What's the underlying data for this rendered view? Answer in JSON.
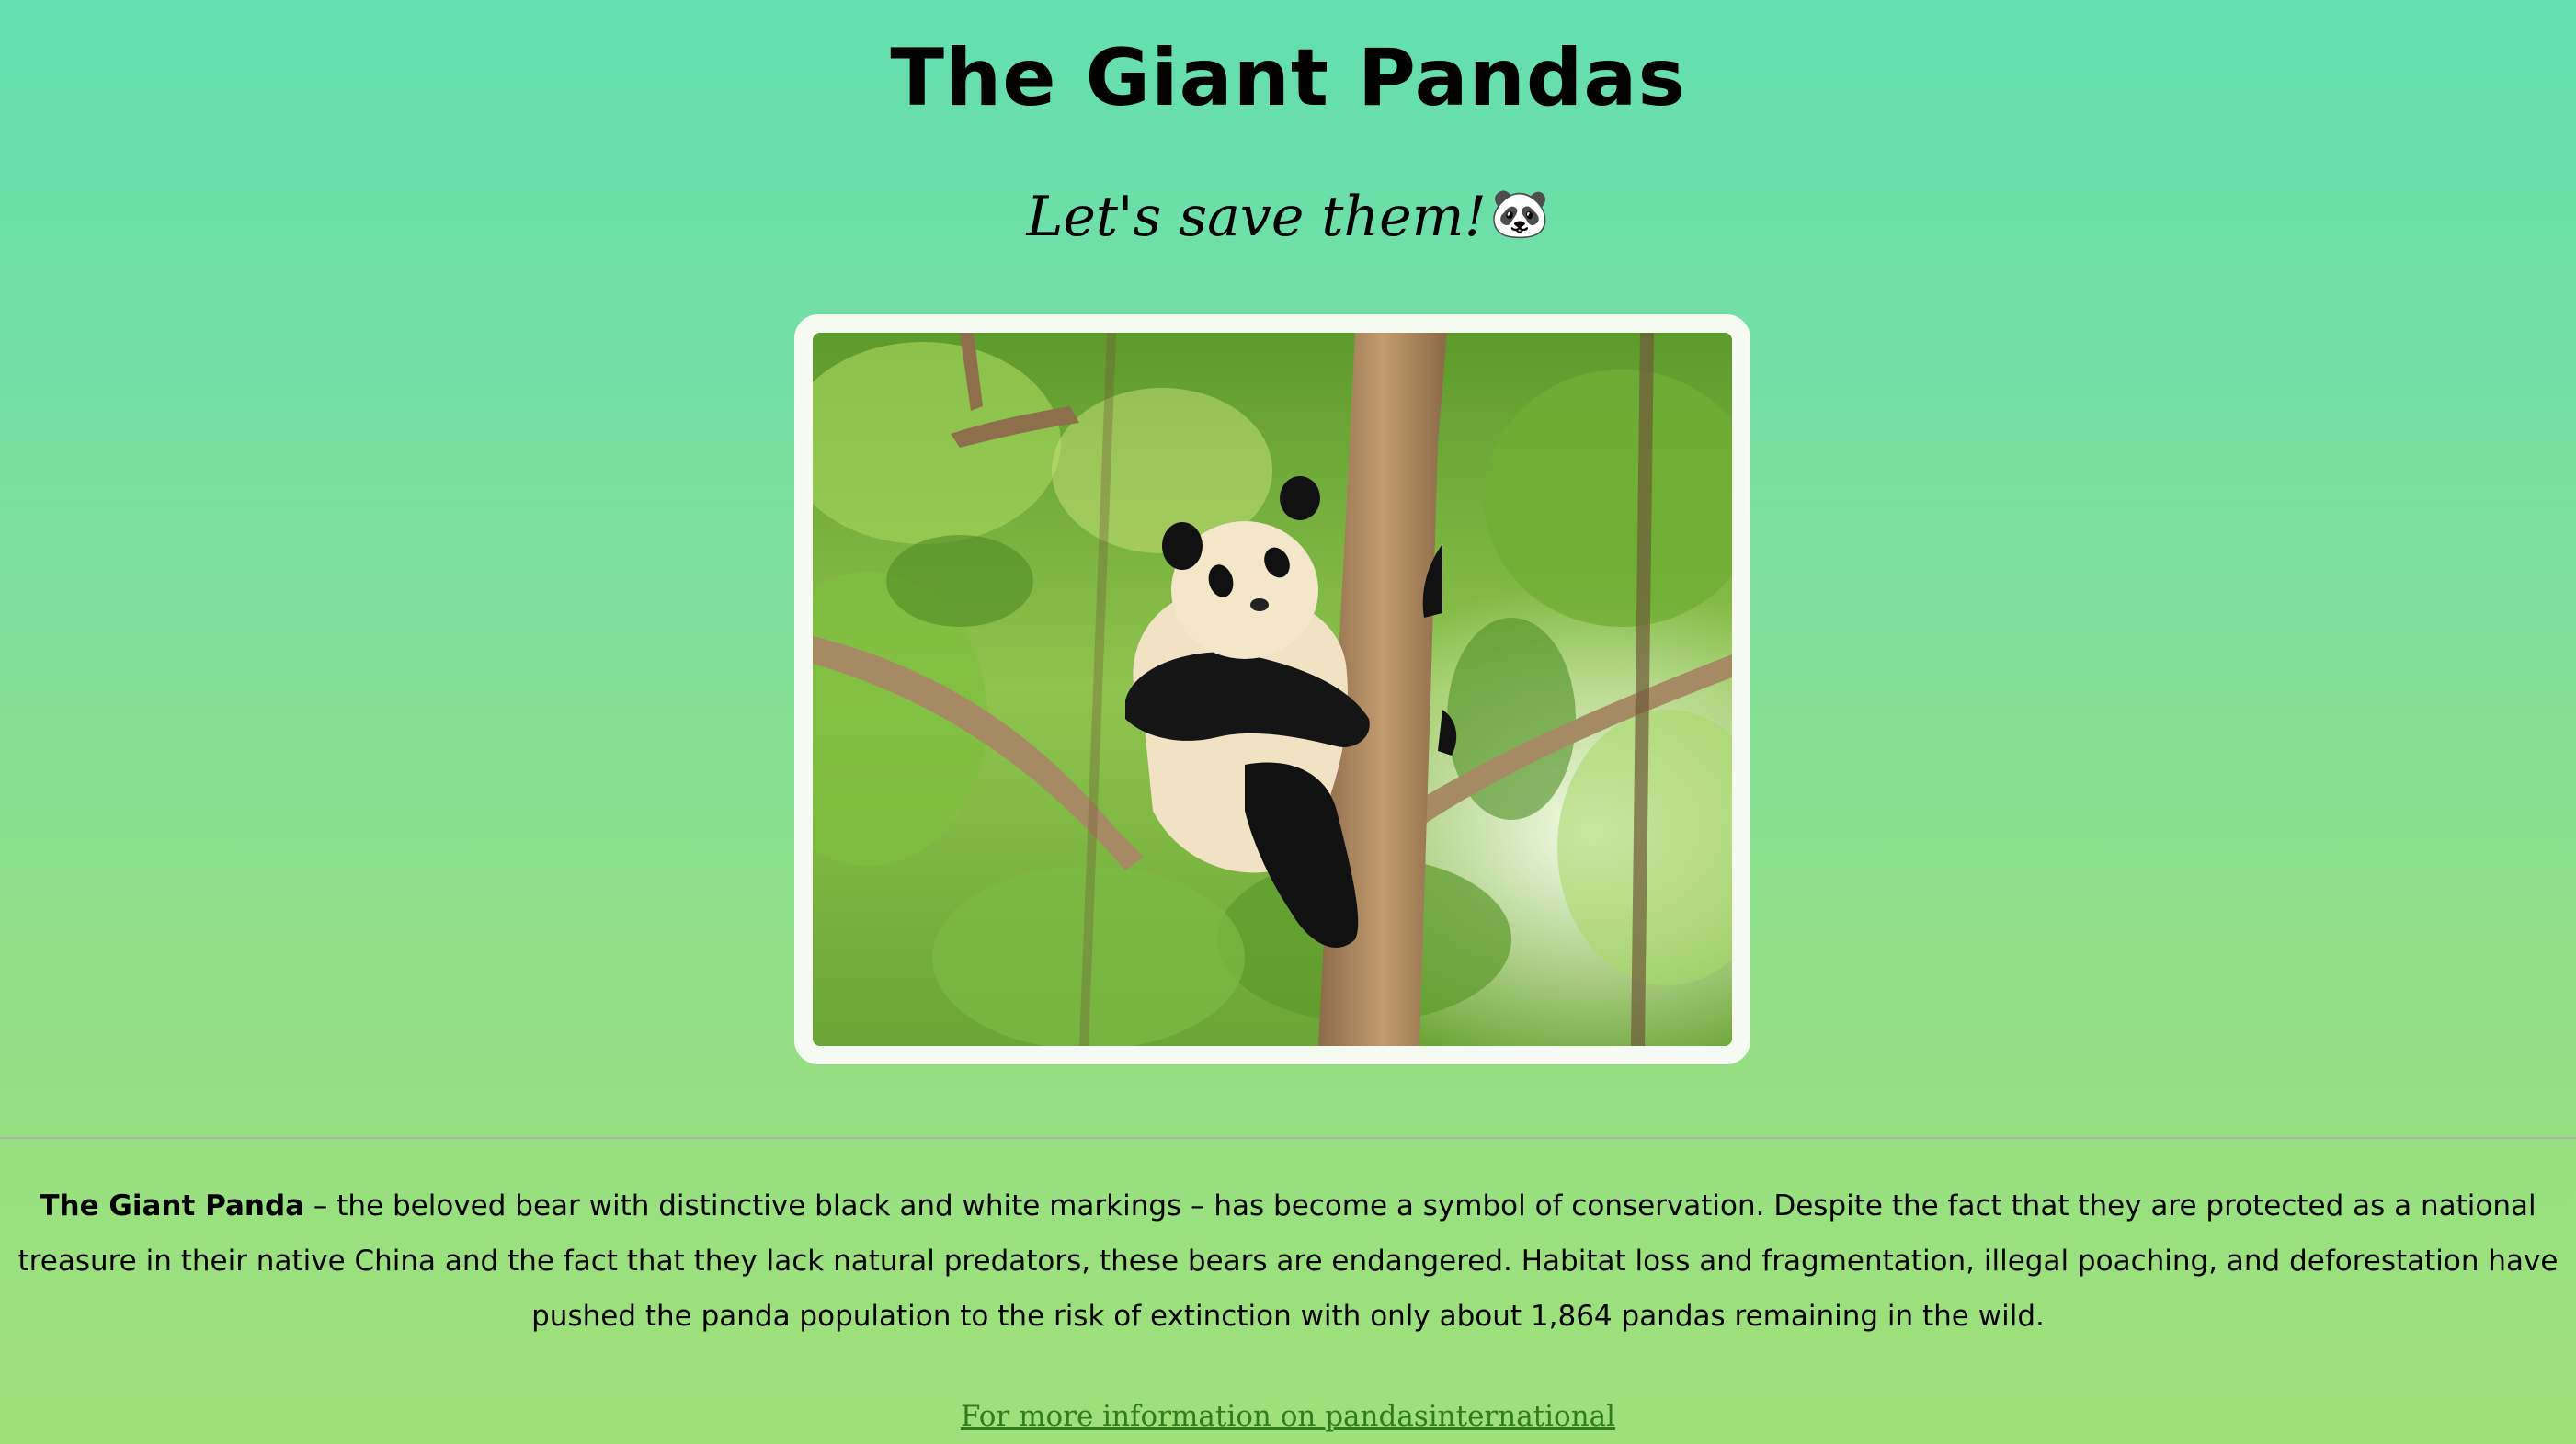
{
  "header": {
    "title": "The Giant Pandas",
    "subtitle": "Let's save them!",
    "subtitle_emoji": "🐼"
  },
  "hero_image": {
    "subject": "giant panda clinging to a tree trunk among green leaves",
    "icon": "panda-photo"
  },
  "article": {
    "lead": "The Giant Panda",
    "body": " – the beloved bear with distinctive black and white markings – has become a symbol of conservation. Despite the fact that they are protected as a national treasure in their native China and the fact that they lack natural predators, these bears are endangered. Habitat loss and fragmentation, illegal poaching, and deforestation have pushed the panda population to the risk of extinction with only about 1,864 pandas remaining in the wild."
  },
  "footer": {
    "link_text": "For more information on pandasinternational"
  },
  "colors": {
    "background_top": "#62dfb0",
    "background_bottom": "#a0e07a",
    "frame": "#f6fbf2",
    "link": "#2f7d1c"
  }
}
